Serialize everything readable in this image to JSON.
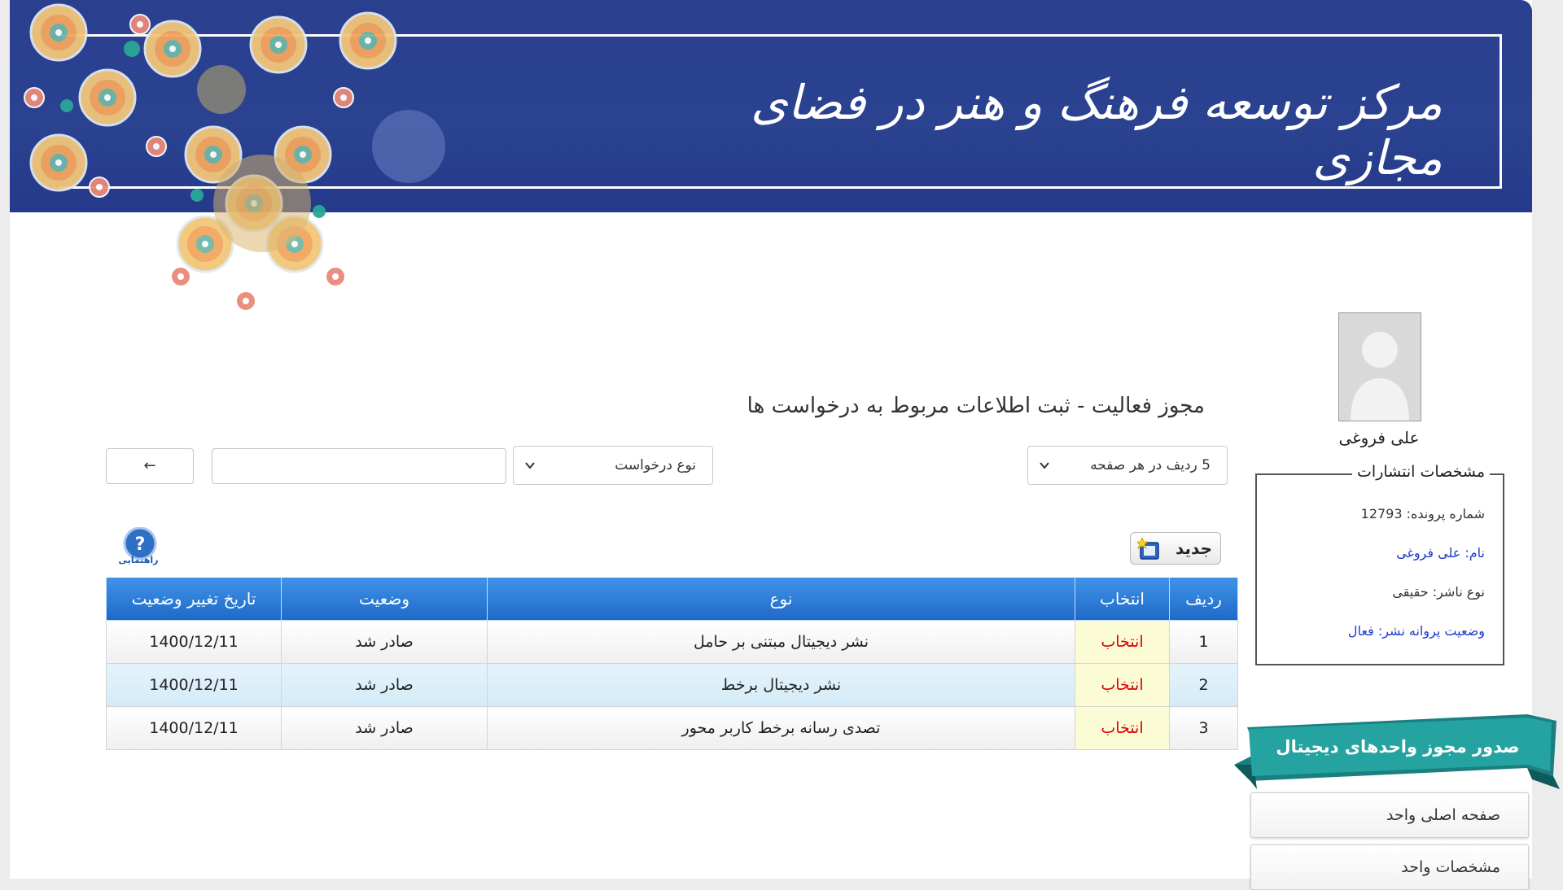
{
  "banner": {
    "title": "مرکز توسعه فرهنگ و هنر در فضای مجازی"
  },
  "colors": {
    "banner": "#2b3f8f",
    "header": "#2c7dd8",
    "ribbon": "#1f8b8b",
    "select_text": "#e00000"
  },
  "sidebar": {
    "user_name": "علی فروغی",
    "legend": "مشخصات انتشارات",
    "file_number": "شماره پرونده: 12793",
    "name": "نام: علی فروغی",
    "publisher_type": "نوع ناشر: حقیقی",
    "license_status": "وضعیت پروانه نشر: فعال",
    "ribbon": "صدور مجوز واحدهای دیجیتال",
    "menu": [
      "صفحه اصلی واحد",
      "مشخصات واحد"
    ]
  },
  "main": {
    "title": "مجوز فعالیت - ثبت اطلاعات مربوط به درخواست ها",
    "rows_per_page": "5 ردیف در هر صفحه",
    "request_type": "نوع درخواست",
    "search_value": "",
    "back_arrow": "←",
    "new_button": "جدید",
    "help_label": "راهنمایی",
    "help_mark": "?"
  },
  "table": {
    "headers": [
      "ردیف",
      "انتخاب",
      "نوع",
      "وضعیت",
      "تاریخ تغییر وضعیت"
    ],
    "rows": [
      {
        "index": "1",
        "select": "انتخاب",
        "type": "نشر دیجیتال مبتنی بر حامل",
        "status": "صادر شد",
        "date": "1400/12/11"
      },
      {
        "index": "2",
        "select": "انتخاب",
        "type": "نشر دیجیتال برخط",
        "status": "صادر شد",
        "date": "1400/12/11"
      },
      {
        "index": "3",
        "select": "انتخاب",
        "type": "تصدی رسانه برخط کاربر محور",
        "status": "صادر شد",
        "date": "1400/12/11"
      }
    ]
  }
}
